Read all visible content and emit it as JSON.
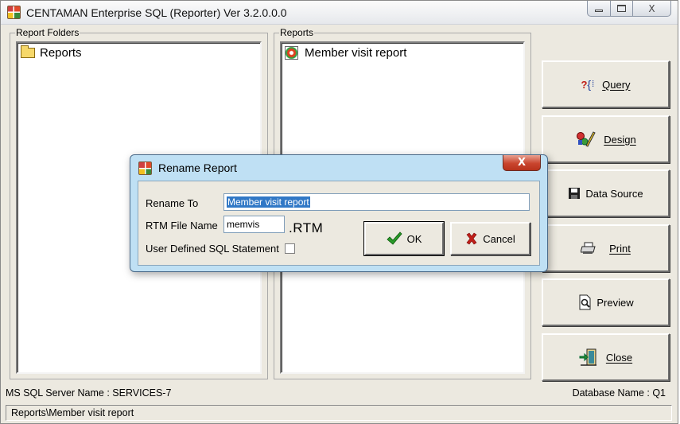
{
  "window": {
    "title": "CENTAMAN Enterprise SQL (Reporter) Ver 3.2.0.0.0",
    "min_label": "",
    "close_label": "X"
  },
  "folders_panel": {
    "legend": "Report Folders",
    "items": [
      {
        "label": "Reports"
      }
    ]
  },
  "reports_panel": {
    "legend": "Reports",
    "items": [
      {
        "label": "Member visit report"
      }
    ]
  },
  "side_buttons": {
    "query": {
      "label": "Query",
      "icon_text": "?{",
      "icon": "query-icon"
    },
    "design": {
      "label": "Design",
      "icon": "design-icon"
    },
    "data_source": {
      "label": "Data Source",
      "icon": "floppy-disk-icon"
    },
    "print": {
      "label": "Print",
      "icon": "printer-icon"
    },
    "preview": {
      "label": "Preview",
      "icon": "preview-icon"
    },
    "close": {
      "label": "Close",
      "icon": "exit-door-icon"
    }
  },
  "status": {
    "server": "MS SQL Server Name : SERVICES-7",
    "database": "Database Name : Q1",
    "path": "Reports\\Member visit report"
  },
  "dialog": {
    "title": "Rename Report",
    "close_label": "X",
    "rename_to_label": "Rename To",
    "rename_to_value": "Member visit report",
    "rtm_file_label": "RTM File Name",
    "rtm_file_value": "memvis",
    "rtm_ext": ".RTM",
    "sql_label": "User Defined SQL Statement",
    "sql_checked": false,
    "ok_label": "OK",
    "cancel_label": "Cancel"
  },
  "colors": {
    "window_bg": "#ece9e0",
    "dialog_frame": "#bfe0f4",
    "selection": "#3178c6",
    "ok_check": "#2a9a2a",
    "cancel_x": "#c0201a"
  }
}
